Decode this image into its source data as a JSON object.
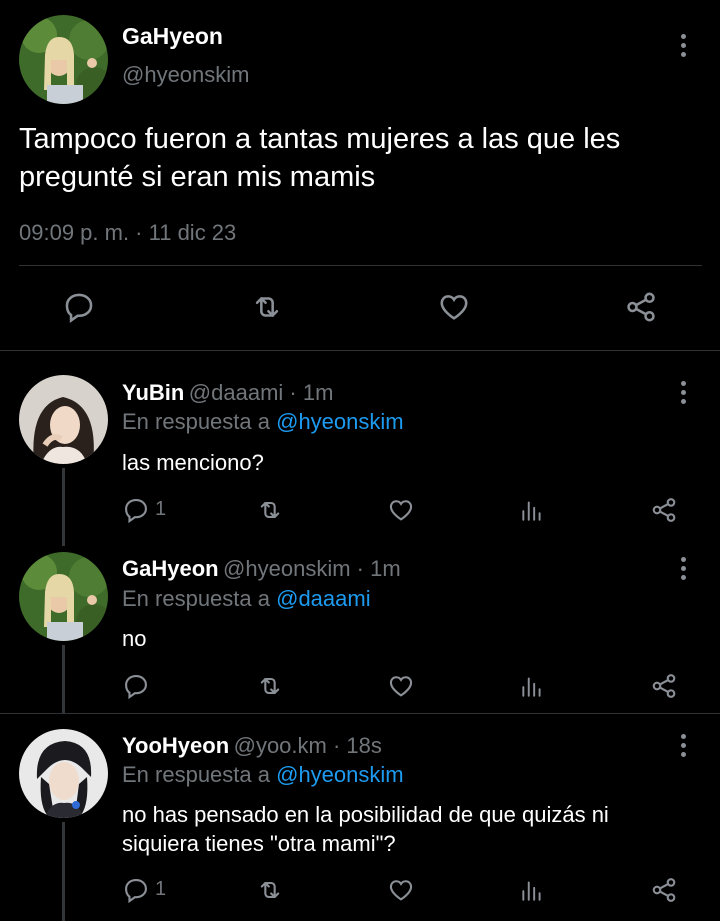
{
  "main": {
    "name": "GaHyeon",
    "handle": "@hyeonskim",
    "text_line1": "Tampoco fueron a tantas mujeres a las que les",
    "text_line2": "pregunté si eran mis mamis",
    "timestamp": "09:09 p. m. · 11 dic 23",
    "actions": [
      "reply-icon",
      "retweet-icon",
      "like-icon",
      "share-icon"
    ]
  },
  "replies": [
    {
      "name": "YuBin",
      "meta": "@daaami · 1m",
      "reply_prefix": "En respuesta a",
      "reply_to": "@hyeonskim",
      "text_line1": "las menciono?",
      "text_line2": "",
      "reply_count": "1"
    },
    {
      "name": "GaHyeon",
      "meta": "@hyeonskim · 1m",
      "reply_prefix": "En respuesta a",
      "reply_to": "@daaami",
      "text_line1": "no",
      "text_line2": "",
      "reply_count": ""
    },
    {
      "name": "YooHyeon",
      "meta": "@yoo.km · 18s",
      "reply_prefix": "En respuesta a",
      "reply_to": "@hyeonskim",
      "text_line1": "no has pensado en la posibilidad de que quizás ni",
      "text_line2": "siquiera tienes \"otra mami\"?",
      "reply_count": "1"
    }
  ],
  "colors": {
    "background": "#000000",
    "secondary_text": "#71767b",
    "link": "#1d9bf0",
    "divider": "#2f3336"
  }
}
